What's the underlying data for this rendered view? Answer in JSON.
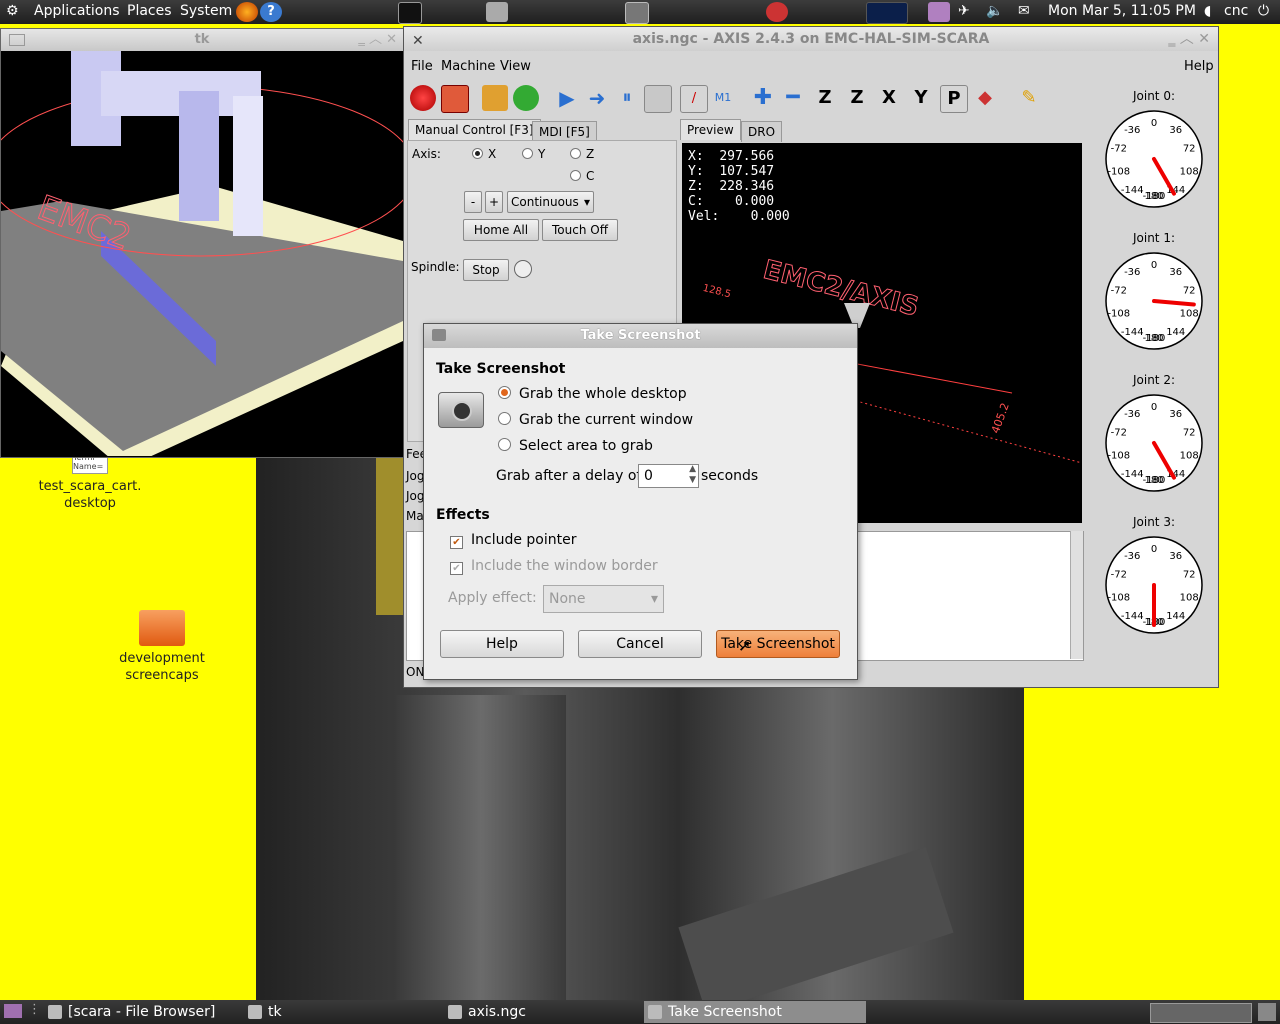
{
  "top_panel": {
    "applications": "Applications",
    "places": "Places",
    "system": "System",
    "clock": "Mon Mar  5, 11:05 PM",
    "user": "cnc"
  },
  "desktop_icons": [
    {
      "label_line1": "test_scara_cart.",
      "label_line2": "desktop",
      "small_text": "Termi Name="
    },
    {
      "label_line1": "development",
      "label_line2": "screencaps"
    }
  ],
  "tk_window": {
    "title": "tk"
  },
  "axis_window": {
    "title": "axis.ngc - AXIS 2.4.3 on EMC-HAL-SIM-SCARA",
    "menus": {
      "file": "File",
      "machine": "Machine",
      "view": "View",
      "help": "Help"
    },
    "tabs_left": {
      "manual": "Manual Control [F3]",
      "mdi": "MDI [F5]"
    },
    "tabs_right": {
      "preview": "Preview",
      "dro": "DRO"
    },
    "axis_label": "Axis:",
    "axis_options": [
      "X",
      "Y",
      "Z",
      "C"
    ],
    "jog": {
      "minus": "-",
      "plus": "+",
      "mode": "Continuous"
    },
    "home_all": "Home All",
    "touch_off": "Touch Off",
    "spindle_label": "Spindle:",
    "spindle_stop": "Stop",
    "side_labels": [
      "Fee",
      "Jog",
      "Jog",
      "Ma"
    ],
    "status_on": "ON",
    "dro": {
      "x_label": "X:",
      "x": "297.566",
      "y_label": "Y:",
      "y": "107.547",
      "z_label": "Z:",
      "z": "228.346",
      "c_label": "C:",
      "c": "0.000",
      "vel_label": "Vel:",
      "vel": "0.000"
    },
    "preview_text": {
      "logo": "EMC2/AXIS",
      "dim1": "405.2",
      "dim2": "128.5"
    },
    "joints": [
      {
        "label": "Joint 0:",
        "angle": 150
      },
      {
        "label": "Joint 1:",
        "angle": 95
      },
      {
        "label": "Joint 2:",
        "angle": 150
      },
      {
        "label": "Joint 3:",
        "angle": 180
      }
    ],
    "gauge_ticks": [
      "0",
      "36",
      "72",
      "108",
      "144",
      "180",
      "-36",
      "-72",
      "-108",
      "-144",
      "-180"
    ]
  },
  "dialog": {
    "titlebar": "Take Screenshot",
    "heading": "Take Screenshot",
    "options": [
      "Grab the whole desktop",
      "Grab the current window",
      "Select area to grab"
    ],
    "selected_option": 0,
    "delay_label": "Grab after a delay of",
    "delay_value": "0",
    "delay_unit": "seconds",
    "effects_heading": "Effects",
    "include_pointer": "Include pointer",
    "include_border": "Include the window border",
    "apply_effect_label": "Apply effect:",
    "apply_effect_value": "None",
    "help_button": "Help",
    "cancel_button": "Cancel",
    "take_button": "Take Screenshot"
  },
  "taskbar": [
    {
      "label": "[scara - File Browser]"
    },
    {
      "label": "tk"
    },
    {
      "label": "axis.ngc"
    },
    {
      "label": "Take Screenshot"
    }
  ],
  "colors": {
    "wallpaper": "#ffff00",
    "accent": "#ee7f3a"
  }
}
